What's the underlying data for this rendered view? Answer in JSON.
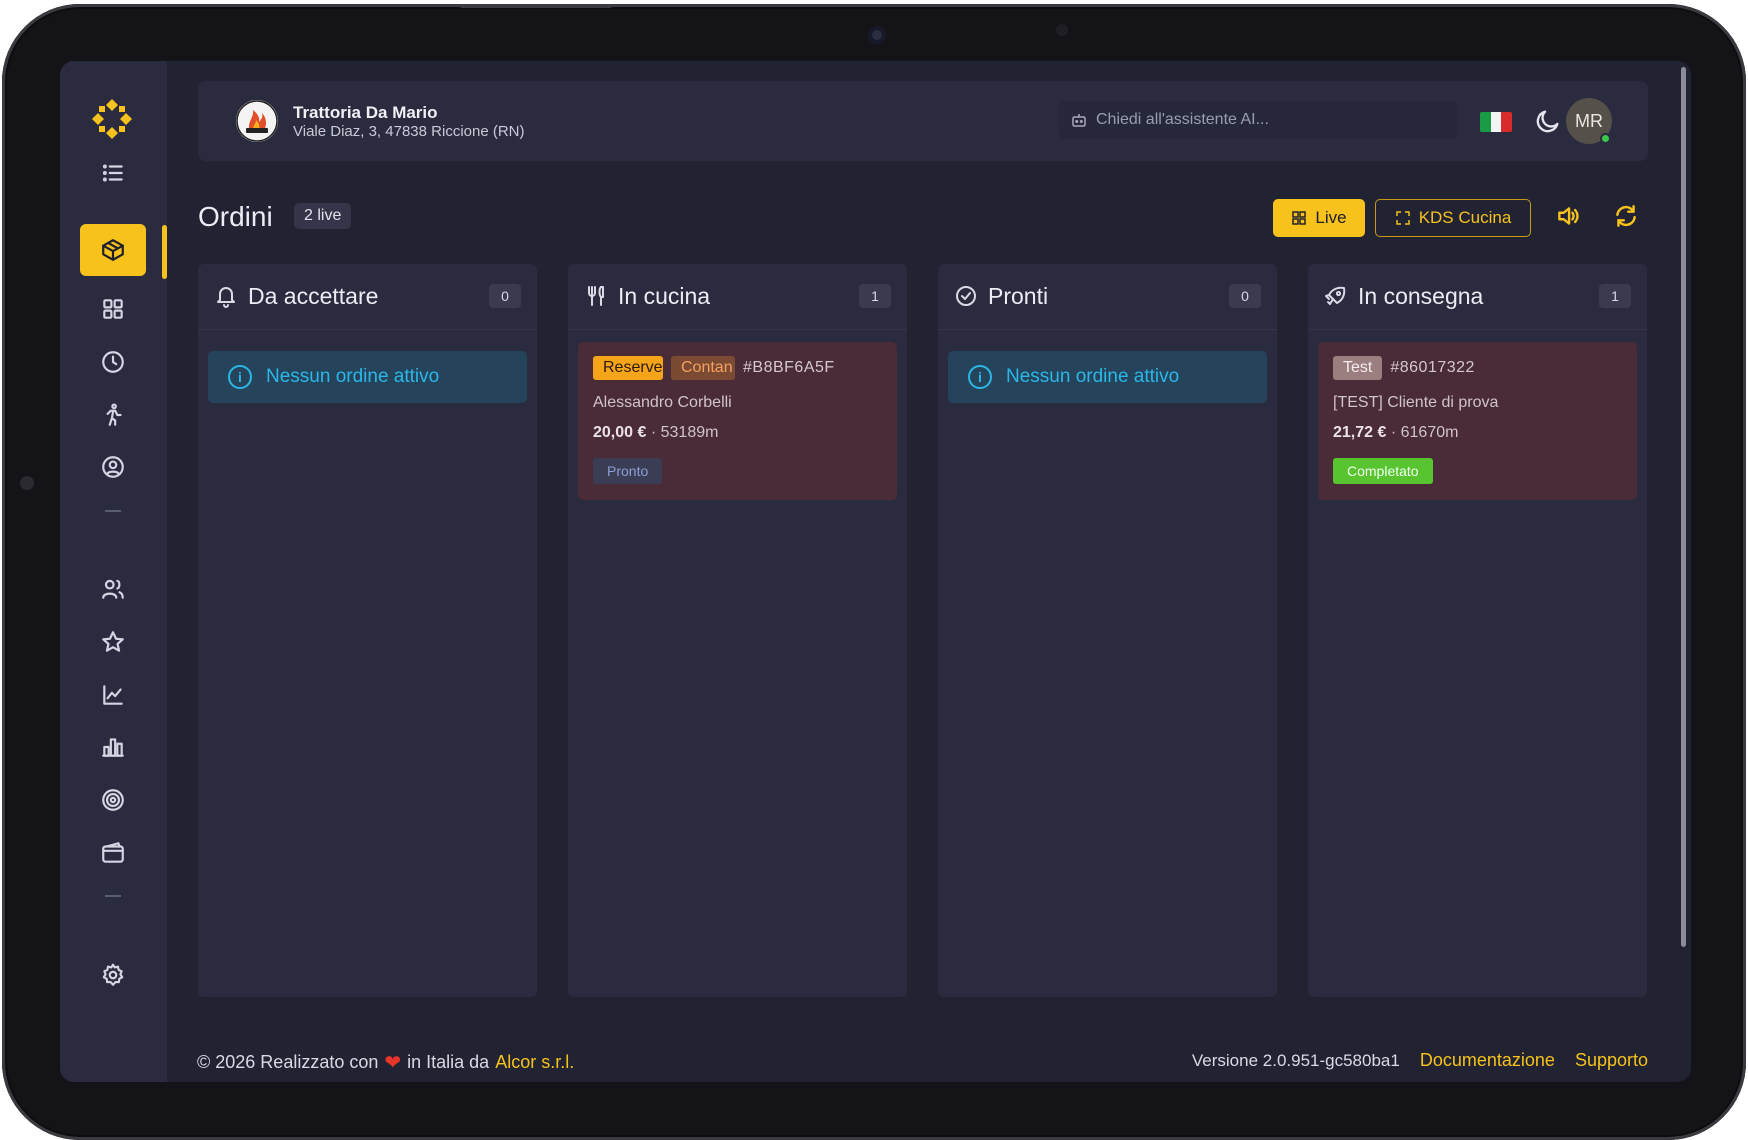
{
  "restaurant": {
    "name": "Trattoria Da Mario",
    "address": "Viale Diaz, 3, 47838 Riccione (RN)"
  },
  "header": {
    "ai_placeholder": "Chiedi all'assistente AI...",
    "language_flag": "italian-flag",
    "avatar_initials": "MR",
    "colors": {
      "accent": "#f6c21b",
      "online": "#3cc94b"
    }
  },
  "sidebar": {
    "items": [
      {
        "icon": "list-icon"
      },
      {
        "icon": "package-icon",
        "active": true
      },
      {
        "icon": "grid-icon"
      },
      {
        "icon": "clock-icon"
      },
      {
        "icon": "runner-icon"
      },
      {
        "icon": "user-circle-icon"
      },
      {
        "icon": "users-icon"
      },
      {
        "icon": "star-icon"
      },
      {
        "icon": "line-chart-icon"
      },
      {
        "icon": "bar-chart-icon"
      },
      {
        "icon": "target-icon"
      },
      {
        "icon": "wallet-icon"
      },
      {
        "icon": "gear-icon"
      }
    ]
  },
  "page": {
    "title": "Ordini",
    "live_badge": "2 live",
    "live_button": "Live",
    "kds_button": "KDS Cucina"
  },
  "columns": [
    {
      "title": "Da accettare",
      "count": "0",
      "icon": "bell-icon",
      "empty_text": "Nessun ordine attivo"
    },
    {
      "title": "In cucina",
      "count": "1",
      "icon": "utensils-icon"
    },
    {
      "title": "Pronti",
      "count": "0",
      "icon": "check-circle-icon",
      "empty_text": "Nessun ordine attivo"
    },
    {
      "title": "In consegna",
      "count": "1",
      "icon": "rocket-icon"
    }
  ],
  "orders": {
    "kitchen": {
      "tag1": "Reserve",
      "tag2": "Contan",
      "id": "#B8BF6A5F",
      "customer": "Alessandro Corbelli",
      "price": "20,00 €",
      "elapsed": "53189m",
      "action": "Pronto"
    },
    "delivery": {
      "tag": "Test",
      "id": "#86017322",
      "customer": "[TEST] Cliente di prova",
      "price": "21,72 €",
      "elapsed": "61670m",
      "action": "Completato"
    }
  },
  "footer": {
    "prefix": "© 2026 Realizzato con",
    "middle": "in Italia da",
    "company": "Alcor s.r.l.",
    "version": "Versione 2.0.951-gc580ba1",
    "docs": "Documentazione",
    "support": "Supporto"
  }
}
